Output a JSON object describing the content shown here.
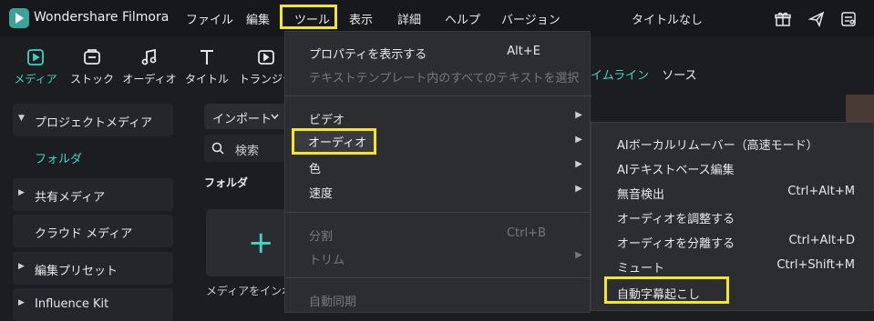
{
  "app": {
    "name": "Wondershare Filmora",
    "document_title": "タイトルなし"
  },
  "menubar": [
    {
      "label": "ファイル"
    },
    {
      "label": "編集"
    },
    {
      "label": "ツール"
    },
    {
      "label": "表示"
    },
    {
      "label": "詳細"
    },
    {
      "label": "ヘルプ"
    },
    {
      "label": "バージョン"
    }
  ],
  "title_icons": [
    "gift-icon",
    "share-icon",
    "settings-icon"
  ],
  "toolbar": [
    {
      "label": "メディア",
      "icon": "media-icon"
    },
    {
      "label": "ストック",
      "icon": "stock-icon"
    },
    {
      "label": "オーディオ",
      "icon": "audio-icon"
    },
    {
      "label": "タイトル",
      "icon": "title-icon"
    },
    {
      "label": "トランジシ",
      "icon": "transition-icon"
    }
  ],
  "side": {
    "project_media": "プロジェクトメディア",
    "folder": "フォルダ",
    "shared_media": "共有メディア",
    "cloud_media": "クラウド メディア",
    "edit_presets": "編集プリセット",
    "influence_kit": "Influence Kit"
  },
  "media": {
    "import_label": "インポート",
    "search_placeholder": "検索",
    "folder_label": "フォルダ",
    "import_caption": "メディアをインポー"
  },
  "preview_tabs": {
    "timeline": "イムライン",
    "source": "ソース"
  },
  "tools_menu": {
    "properties": {
      "label": "プロパティを表示する",
      "shortcut": "Alt+E"
    },
    "select_text": {
      "label": "テキストテンプレート内のすべてのテキストを選択"
    },
    "video": {
      "label": "ビデオ"
    },
    "audio": {
      "label": "オーディオ"
    },
    "color": {
      "label": "色"
    },
    "speed": {
      "label": "速度"
    },
    "split": {
      "label": "分割",
      "shortcut": "Ctrl+B"
    },
    "trim": {
      "label": "トリム"
    },
    "auto_sync": {
      "label": "自動同期"
    }
  },
  "audio_submenu": [
    {
      "label": "AIボーカルリムーバー（高速モード）",
      "shortcut": ""
    },
    {
      "label": "AIテキストベース編集",
      "shortcut": ""
    },
    {
      "label": "無音検出",
      "shortcut": "Ctrl+Alt+M"
    },
    {
      "label": "オーディオを調整する",
      "shortcut": ""
    },
    {
      "label": "オーディオを分離する",
      "shortcut": "Ctrl+Alt+D"
    },
    {
      "label": "ミュート",
      "shortcut": "Ctrl+Shift+M"
    },
    {
      "label": "自動字幕起こし",
      "shortcut": ""
    }
  ],
  "colors": {
    "accent": "#41d5c2",
    "highlight": "#f5e71a",
    "menu_bg": "#2c2d31"
  }
}
